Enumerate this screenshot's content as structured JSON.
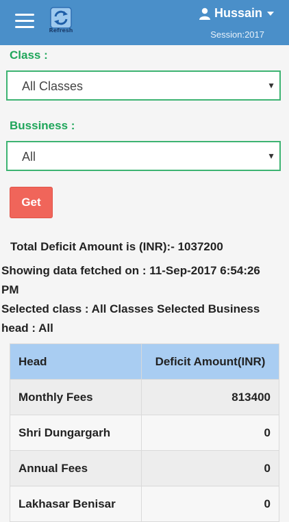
{
  "header": {
    "refresh_label": "Refresh",
    "user_name": "Hussain",
    "session": "Session:2017"
  },
  "form": {
    "class_label": "Class :",
    "class_value": "All Classes",
    "business_label": "Bussiness :",
    "business_value": "All",
    "get_label": "Get"
  },
  "summary": {
    "total": "Total Deficit Amount is (INR):- 1037200",
    "fetched_line1": "Showing data fetched on : 11-Sep-2017 6:54:26",
    "fetched_line2": "PM",
    "selected_line1": "Selected class : All Classes Selected Business",
    "selected_line2": "head : All"
  },
  "table": {
    "headers": [
      "Head",
      "Deficit Amount(INR)"
    ],
    "rows": [
      {
        "head": "Monthly Fees",
        "amount": "813400"
      },
      {
        "head": "Shri Dungargarh",
        "amount": "0"
      },
      {
        "head": "Annual Fees",
        "amount": "0"
      },
      {
        "head": "Lakhasar Benisar",
        "amount": "0"
      }
    ]
  },
  "colors": {
    "header_bg": "#4a8fc9",
    "label_green": "#1fa65a",
    "get_button": "#f0655a",
    "table_header": "#a9cdf2"
  },
  "icons": {
    "menu": "hamburger-icon",
    "refresh": "refresh-icon",
    "user": "user-icon",
    "dropdown": "caret-down-icon"
  }
}
